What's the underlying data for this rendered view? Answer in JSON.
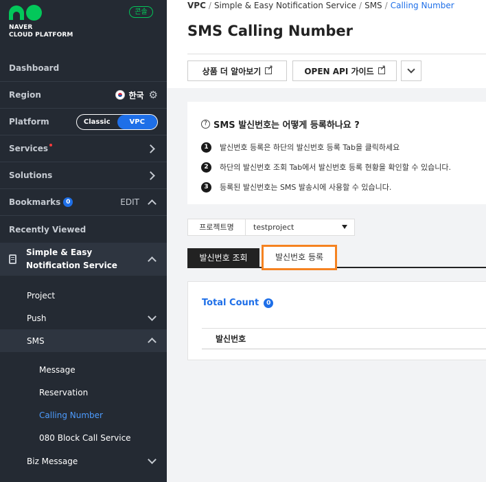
{
  "sidebar": {
    "brand_line1": "NAVER",
    "brand_line2": "CLOUD PLATFORM",
    "console_badge": "콘솔",
    "dashboard": "Dashboard",
    "region_label": "Region",
    "region_value": "한국",
    "platform_label": "Platform",
    "platform_options": [
      "Classic",
      "VPC"
    ],
    "platform_selected": "VPC",
    "services": "Services",
    "solutions": "Solutions",
    "bookmarks": "Bookmarks",
    "bookmarks_count": "0",
    "edit": "EDIT",
    "recently_viewed": "Recently Viewed",
    "section_title": "Simple & Easy Notification Service",
    "sub_items": {
      "project": "Project",
      "push": "Push",
      "sms": "SMS",
      "biz_message": "Biz Message"
    },
    "sms_items": [
      "Message",
      "Reservation",
      "Calling Number",
      "080 Block Call Service"
    ],
    "sms_active": "Calling Number"
  },
  "header": {
    "breadcrumb": [
      "VPC",
      "Simple & Easy Notification Service",
      "SMS",
      "Calling Number"
    ],
    "title": "SMS Calling Number",
    "buttons": {
      "product_info": "상품 더 알아보기",
      "api_guide": "OPEN API 가이드"
    }
  },
  "info": {
    "question": "SMS 발신번호는 어떻게 등록하나요 ?",
    "steps": [
      {
        "num": "1",
        "text": "발신번호 등록은 하단의 발신번호 등록 Tab을 클릭하세요"
      },
      {
        "num": "2",
        "text": "하단의 발신번호 조회 Tab에서 발신번호 등록 현황을 확인할 수 있습니다."
      },
      {
        "num": "3",
        "text": "등록된 발신번호는 SMS 발송시에 사용할 수 있습니다."
      }
    ]
  },
  "project": {
    "label": "프로젝트명",
    "selected": "testproject"
  },
  "tabs": {
    "lookup": "발신번호 조회",
    "register": "발신번호 등록"
  },
  "table": {
    "total_label": "Total Count",
    "total_count": "0",
    "columns": [
      "발신번호"
    ]
  },
  "colors": {
    "sidebar_bg": "#242a33",
    "accent_blue": "#1e6fe8",
    "brand_green": "#03c75a",
    "highlight_orange": "#f58220"
  }
}
